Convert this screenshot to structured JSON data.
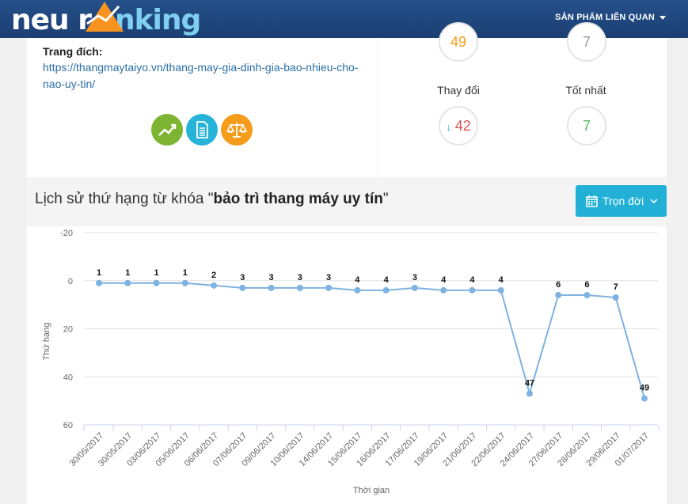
{
  "header": {
    "logo_part1": "neu r",
    "logo_part2": "nking",
    "nav_products": "SẢN PHẨM LIÊN QUAN"
  },
  "page": {
    "destination_label": "Trang đích:",
    "destination_url": "https://thangmaytaiyo.vn/thang-may-gia-dinh-gia-bao-nhieu-cho-nao-uy-tin/"
  },
  "stats": {
    "current_value": "49",
    "top_right_value": "7",
    "change_label": "Thay đổi",
    "change_value": "42",
    "best_label": "Tốt nhất",
    "best_value": "7"
  },
  "history": {
    "title_prefix": "Lịch sử thứ hạng từ khóa \"",
    "keyword": "bảo trì thang máy uy tín",
    "title_suffix": "\"",
    "range_label": "Trọn đời"
  },
  "colors": {
    "accent": "#22b0d6",
    "line": "#7eb2e0",
    "green": "#7db533",
    "orange": "#f59c1a",
    "down_arrow": "#27b3d8",
    "change_text": "#d9534f",
    "best_text": "#5cb85c"
  },
  "chart_data": {
    "type": "line",
    "ylabel": "Thứ hạng",
    "xlabel": "Thời gian",
    "ylim": [
      -20,
      60
    ],
    "y_reversed": true,
    "y_ticks": [
      -20,
      0,
      20,
      40,
      60
    ],
    "grid": true,
    "categories": [
      "30/05/2017",
      "30/05/2017",
      "03/06/2017",
      "05/06/2017",
      "06/06/2017",
      "07/06/2017",
      "09/06/2017",
      "10/06/2017",
      "14/06/2017",
      "15/06/2017",
      "16/06/2017",
      "17/06/2017",
      "19/06/2017",
      "21/06/2017",
      "22/06/2017",
      "24/06/2017",
      "27/06/2017",
      "28/06/2017",
      "29/06/2017",
      "01/07/2017"
    ],
    "series": [
      {
        "values": [
          1,
          1,
          1,
          1,
          2,
          3,
          3,
          3,
          3,
          4,
          4,
          3,
          4,
          4,
          4,
          47,
          6,
          6,
          7,
          49
        ]
      }
    ]
  }
}
